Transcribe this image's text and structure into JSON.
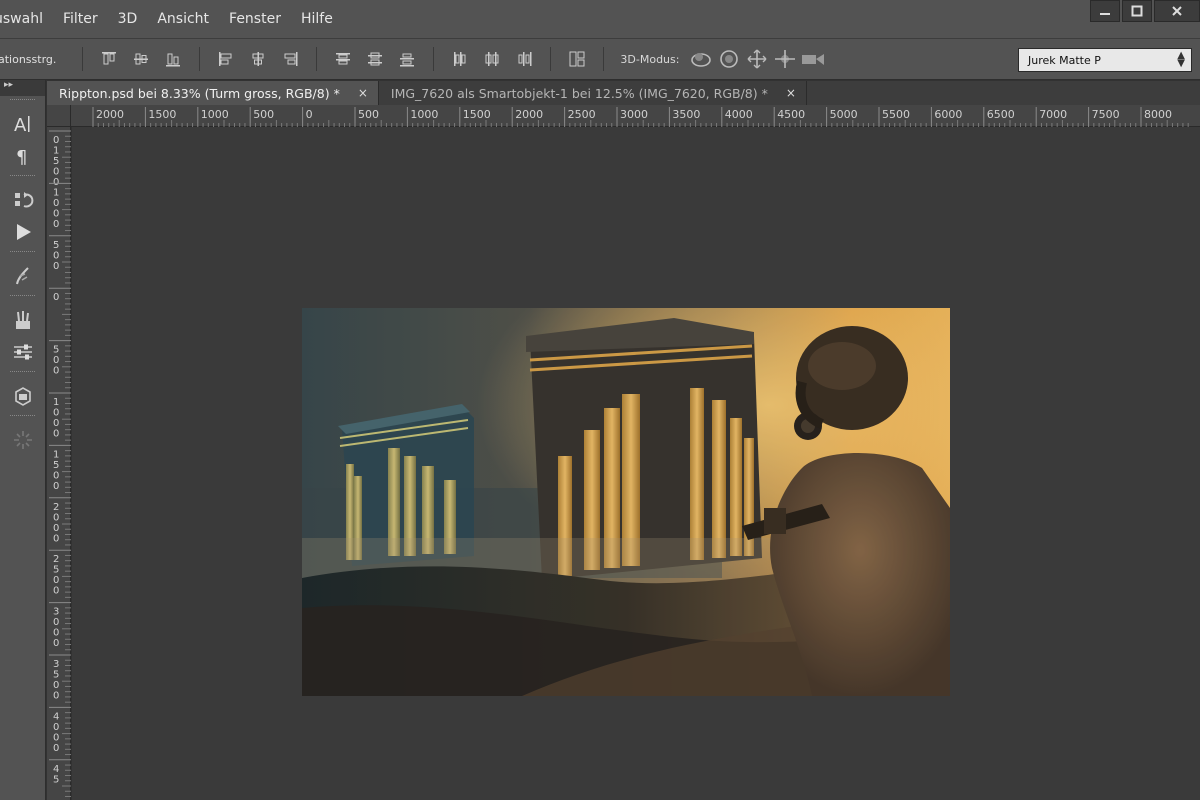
{
  "menu": {
    "items": [
      "uswahl",
      "Filter",
      "3D",
      "Ansicht",
      "Fenster",
      "Hilfe"
    ]
  },
  "window_controls": {
    "minimize": "▁",
    "maximize": "□",
    "close": "✕"
  },
  "options": {
    "label": "ationsstrg.",
    "mode_label": "3D-Modus:",
    "workspace": "Jurek Matte P"
  },
  "toolbar": {
    "collapse": "▸▸"
  },
  "tabs": [
    {
      "label": "Rippton.psd bei 8.33% (Turm gross, RGB/8) *",
      "close": "×"
    },
    {
      "label": "IMG_7620 als Smartobjekt-1 bei 12.5% (IMG_7620, RGB/8) *",
      "close": "×"
    }
  ],
  "ruler_h": {
    "labels": [
      "2000",
      "1500",
      "1000",
      "500",
      "0",
      "500",
      "1000",
      "1500",
      "2000",
      "2500",
      "3000",
      "3500",
      "4000",
      "4500",
      "5000",
      "5500",
      "6000",
      "6500",
      "7000",
      "7500",
      "8000"
    ]
  },
  "ruler_v": {
    "labels": [
      "0 1 5 0 0",
      "1 0 0 0",
      "5 0 0",
      "0",
      "5 0 0",
      "1 0 0 0",
      "1 5 0 0",
      "2 0 0 0",
      "2 5 0 0",
      "3 0 0 0",
      "3 5 0 0",
      "4 0 0 0",
      "4 5"
    ]
  },
  "colors": {
    "chrome": "#535353",
    "canvas": "#3a3a3a",
    "ruler": "#454545"
  }
}
